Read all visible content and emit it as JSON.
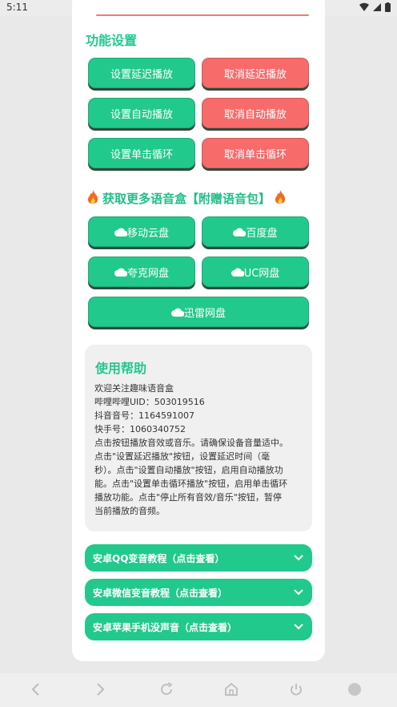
{
  "status": {
    "time": "5:11"
  },
  "section": {
    "title": "功能设置"
  },
  "buttons": {
    "set_delay": "设置延迟播放",
    "cancel_delay": "取消延迟播放",
    "set_auto": "设置自动播放",
    "cancel_auto": "取消自动播放",
    "set_loop": "设置单击循环",
    "cancel_loop": "取消单击循环"
  },
  "promo": {
    "text": "获取更多语音盒【附赠语音包】"
  },
  "cloud_buttons": {
    "mobile": "移动云盘",
    "baidu": "百度盘",
    "quark": "夸克网盘",
    "uc": "UC网盘",
    "xunlei": "迅雷网盘"
  },
  "help": {
    "title": "使用帮助",
    "lines": [
      "欢迎关注趣味语音盒",
      "哔哩哔哩UID：503019516",
      "抖音音号：1164591007",
      "快手号：1060340752",
      "点击按钮播放音效或音乐。请确保设备音量适中。",
      "点击\"设置延迟播放\"按钮，设置延迟时间（毫",
      "秒）。点击\"设置自动播放\"按钮，启用自动播放功",
      "能。点击\"设置单击循环播放\"按钮，启用单击循环",
      "播放功能。点击\"停止所有音效/音乐\"按钮，暂停",
      "当前播放的音频。"
    ]
  },
  "accordions": [
    "安卓QQ变音教程（点击查看）",
    "安卓微信变音教程（点击查看）",
    "安卓苹果手机没声音（点击查看）"
  ],
  "colors": {
    "accent": "#22c98c",
    "danger": "#f76b6b",
    "title": "#24c98f"
  }
}
